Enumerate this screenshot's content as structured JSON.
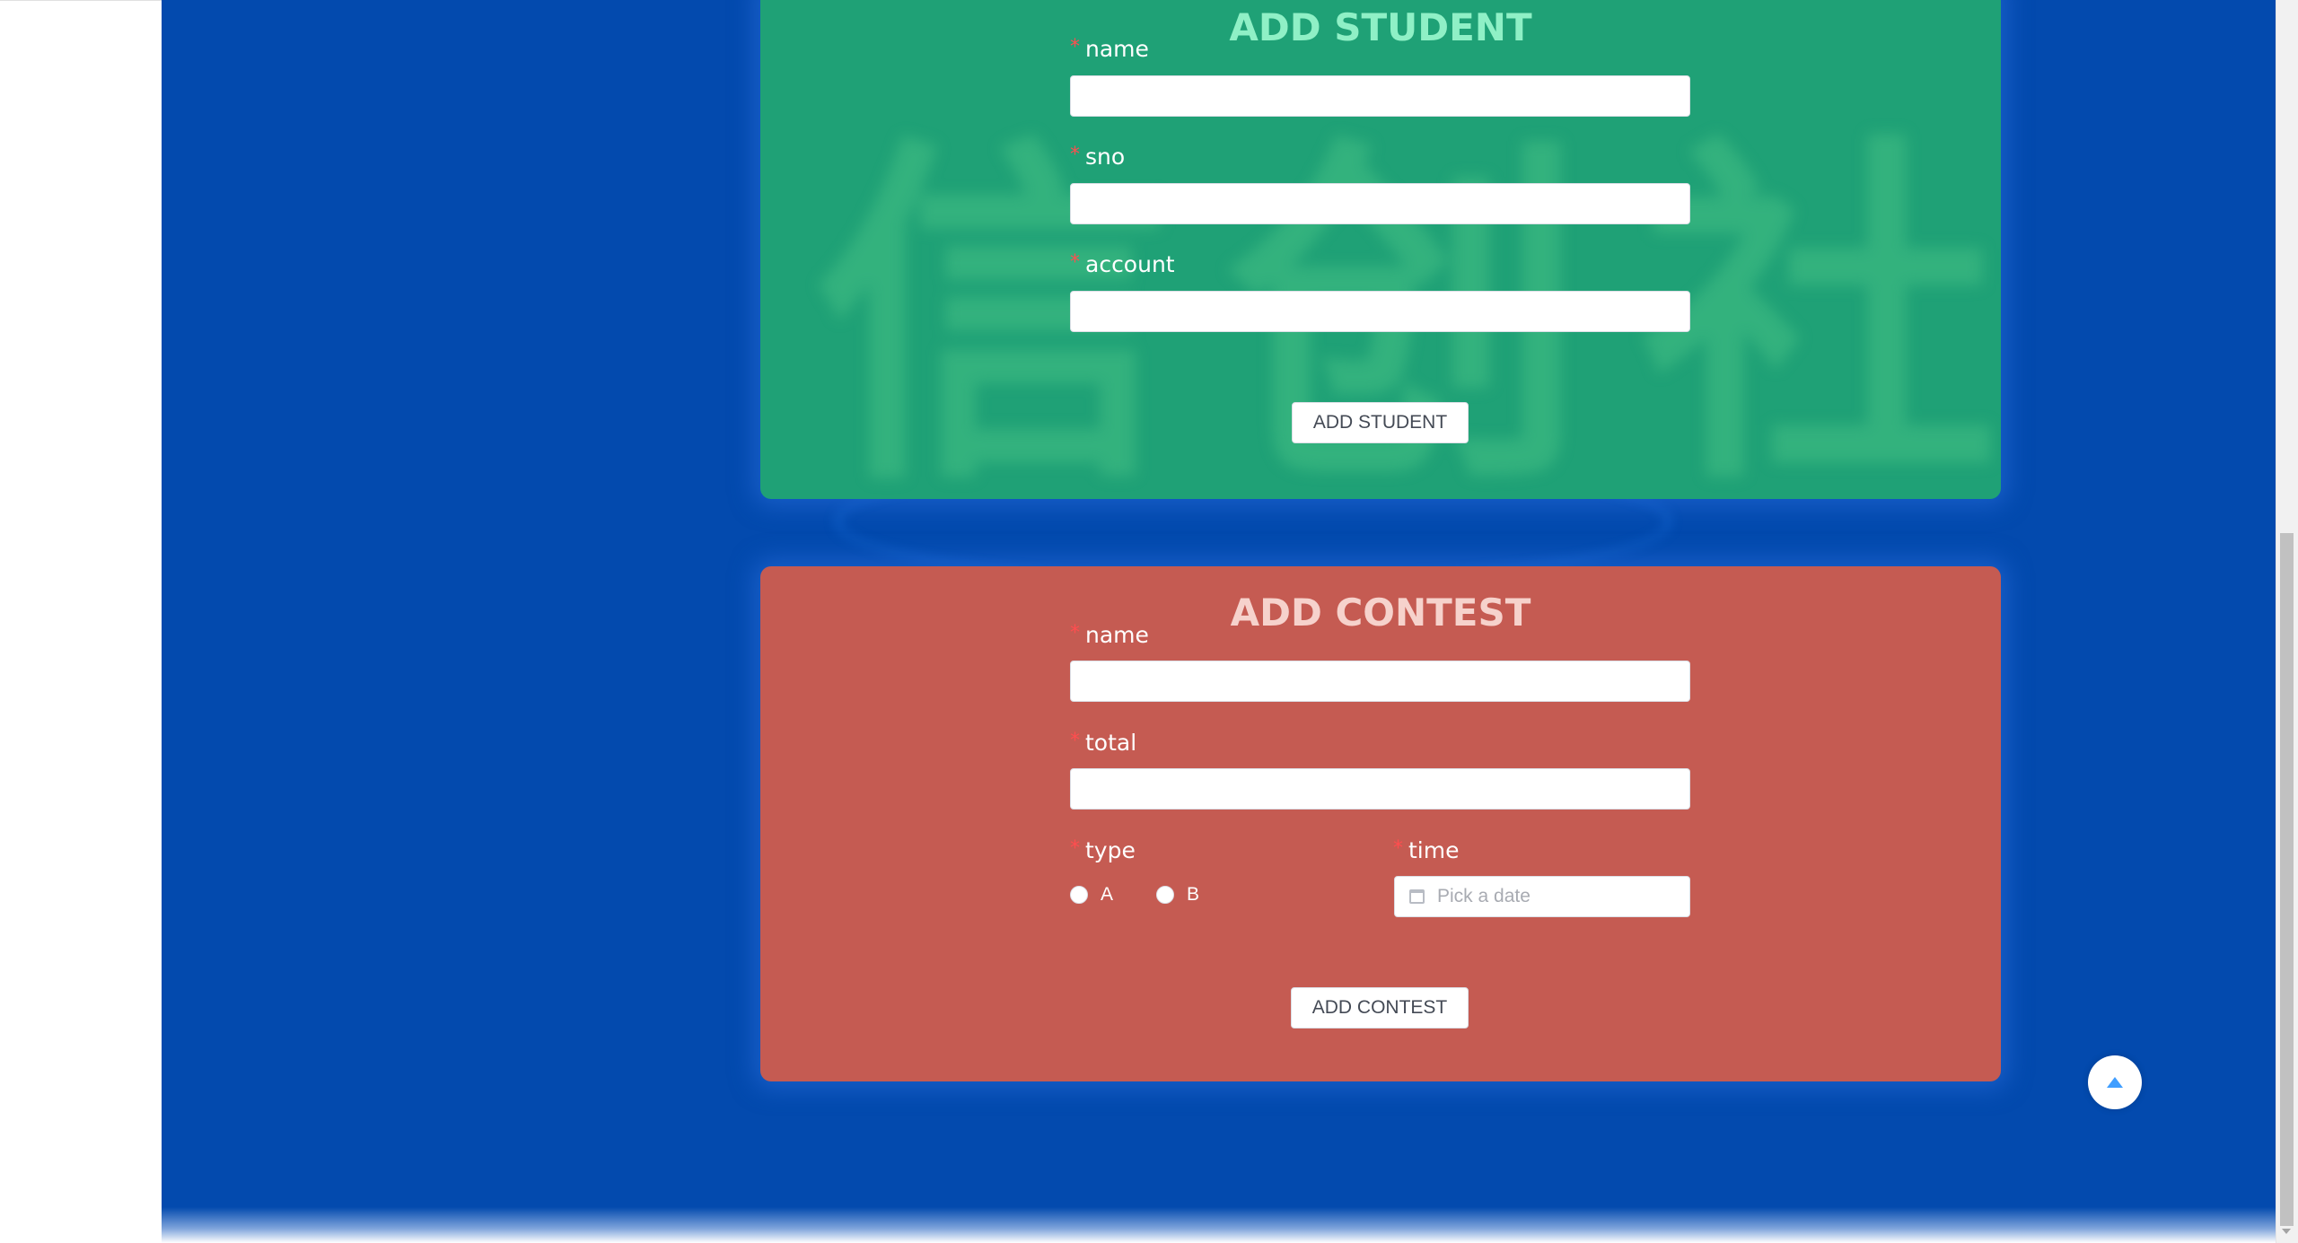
{
  "student_form": {
    "title": "ADD STUDENT",
    "watermark": "信创社",
    "fields": [
      {
        "label": "name",
        "required_mark": "*"
      },
      {
        "label": "sno",
        "required_mark": "*"
      },
      {
        "label": "account",
        "required_mark": "*"
      }
    ],
    "submit_label": "ADD STUDENT"
  },
  "contest_form": {
    "title": "ADD CONTEST",
    "fields": [
      {
        "label": "name",
        "required_mark": "*"
      },
      {
        "label": "total",
        "required_mark": "*"
      }
    ],
    "type": {
      "label": "type",
      "required_mark": "*",
      "options": [
        "A",
        "B"
      ]
    },
    "time": {
      "label": "time",
      "required_mark": "*",
      "placeholder": "Pick a date"
    },
    "submit_label": "ADD CONTEST"
  },
  "colors": {
    "page_background": "#034aae",
    "student_card": "#1fa176",
    "contest_card": "#c55b52",
    "required_mark": "#ff4d4f",
    "back_to_top_arrow": "#409eff"
  },
  "icons": {
    "back_to_top": "caret-up-icon",
    "date_picker": "calendar-icon"
  }
}
